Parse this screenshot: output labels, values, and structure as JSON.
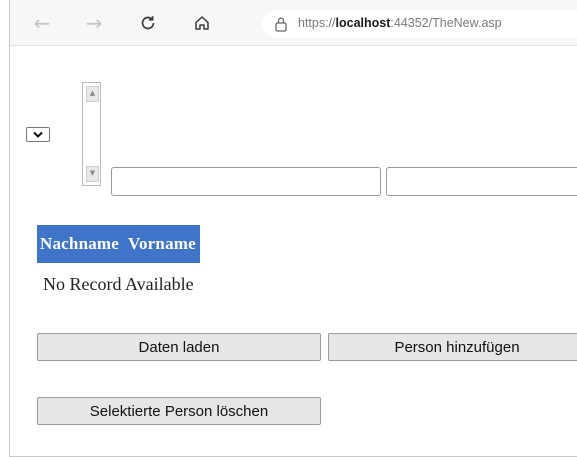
{
  "browser": {
    "url_prefix": "https://",
    "url_host": "localhost",
    "url_rest": ":44352/TheNew.asp",
    "back_icon": "arrow-left-icon",
    "forward_icon": "arrow-right-icon",
    "refresh_icon": "refresh-icon",
    "home_icon": "home-icon",
    "lock_icon": "lock-icon"
  },
  "form": {
    "dropdown_value": "",
    "listbox_items": [],
    "input1_value": "",
    "input2_value": ""
  },
  "grid": {
    "columns": [
      "Nachname",
      "Vorname"
    ],
    "header_color": "#3f74c9",
    "empty_text": "No Record Available"
  },
  "buttons": {
    "load": "Daten laden",
    "add": "Person hinzufügen",
    "delete": "Selektierte Person löschen"
  }
}
